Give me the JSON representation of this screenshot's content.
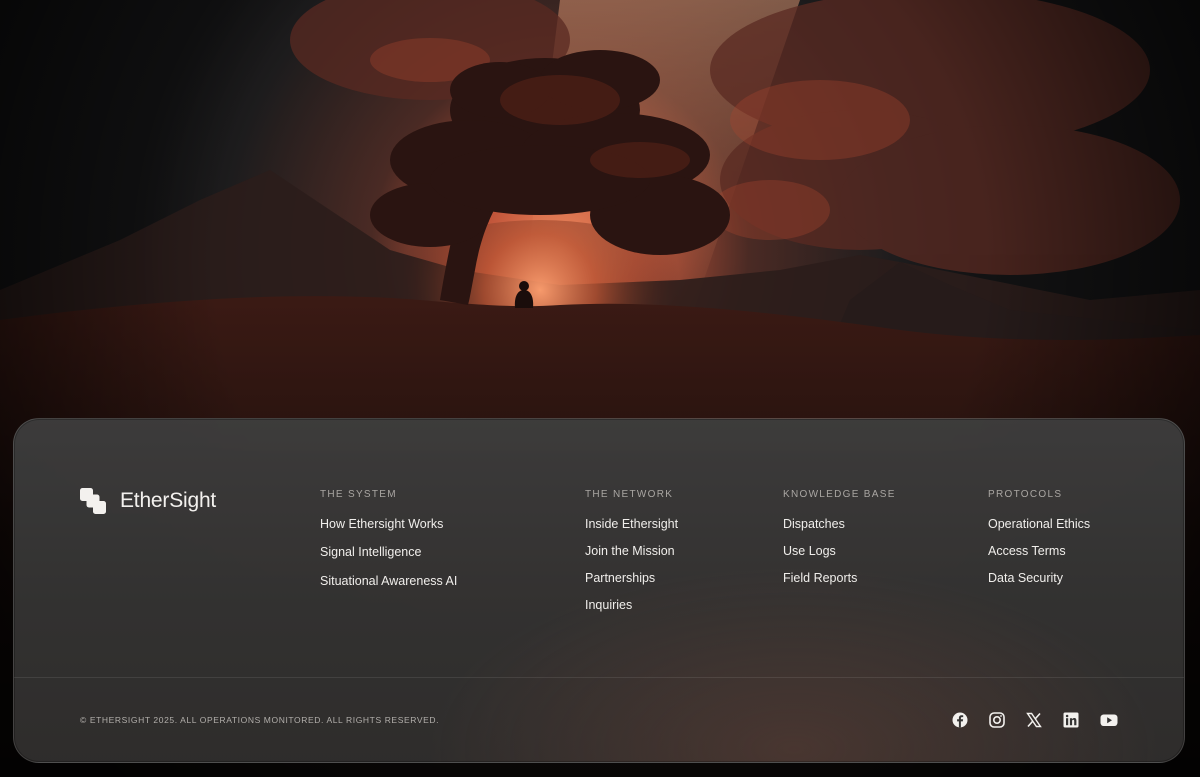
{
  "brand": {
    "name": "EtherSight"
  },
  "footer": {
    "columns": [
      {
        "heading": "THE SYSTEM",
        "links": [
          "How Ethersight Works",
          "Signal Intelligence",
          "Situational Awareness AI"
        ]
      },
      {
        "heading": "THE NETWORK",
        "links": [
          "Inside Ethersight",
          "Join the Mission",
          "Partnerships",
          "Inquiries"
        ]
      },
      {
        "heading": "KNOWLEDGE BASE",
        "links": [
          "Dispatches",
          "Use Logs",
          "Field Reports"
        ]
      },
      {
        "heading": "PROTOCOLS",
        "links": [
          "Operational Ethics",
          "Access Terms",
          "Data Security"
        ]
      }
    ],
    "copyright": "© ETHERSIGHT 2025. ALL OPERATIONS MONITORED. ALL RIGHTS RESERVED.",
    "socials": [
      "facebook-icon",
      "instagram-icon",
      "x-icon",
      "linkedin-icon",
      "youtube-icon"
    ]
  },
  "colors": {
    "accent_glow": "#e0704a",
    "card_bg": "#3a3938",
    "text_primary": "#f0eeeb",
    "text_muted": "#a9a6a2"
  }
}
